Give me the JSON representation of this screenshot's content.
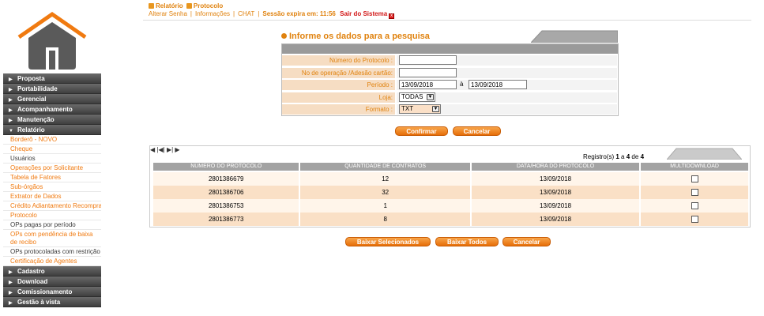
{
  "header": {
    "breadcrumb": {
      "section": "Relatório",
      "page": "Protocolo"
    },
    "links": [
      "Alterar Senha",
      "Informações",
      "CHAT"
    ],
    "session_text": "Sessão expira em: 11:56",
    "logout_label": "Sair do Sistema",
    "logout_icon": "close-x-icon"
  },
  "sidebar": {
    "logo_icon": "house-icon",
    "sections_top": [
      {
        "label": "Proposta",
        "expanded": false
      },
      {
        "label": "Portabilidade",
        "expanded": false
      },
      {
        "label": "Gerencial",
        "expanded": false
      },
      {
        "label": "Acompanhamento",
        "expanded": false
      },
      {
        "label": "Manutenção",
        "expanded": false
      },
      {
        "label": "Relatório",
        "expanded": true
      }
    ],
    "sub_items": [
      {
        "label": "Borderô - NOVO"
      },
      {
        "label": "Cheque"
      },
      {
        "label": "Usuários"
      },
      {
        "label": "Operações por Solicitante"
      },
      {
        "label": "Tabela de Fatores"
      },
      {
        "label": "Sub-órgãos"
      },
      {
        "label": "Extrator de Dados"
      },
      {
        "label": "Crédito Adiantamento Recompra"
      },
      {
        "label": "Protocolo"
      },
      {
        "label": "OPs pagas por período"
      },
      {
        "label": "OPs com pendência de baixa de recibo"
      },
      {
        "label": "OPs protocoladas com restrição"
      },
      {
        "label": "Certificação de Agentes"
      }
    ],
    "sections_bottom": [
      {
        "label": "Cadastro"
      },
      {
        "label": "Download"
      },
      {
        "label": "Comissionamento"
      },
      {
        "label": "Gestão à vista"
      }
    ]
  },
  "form": {
    "title": "Informe os dados para a pesquisa",
    "fields": {
      "protocolo": {
        "label": "Número do Protocolo :",
        "value": ""
      },
      "operacao": {
        "label": "No de operação /Adesão cartão:",
        "value": ""
      },
      "periodo": {
        "label": "Período :",
        "from": "13/09/2018",
        "separator": "à",
        "to": "13/09/2018"
      },
      "loja": {
        "label": "Loja:",
        "value": "TODAS"
      },
      "formato": {
        "label": "Formato :",
        "value": "TXT"
      }
    },
    "confirm_label": "Confirmar",
    "cancel_label": "Cancelar"
  },
  "results": {
    "registros": {
      "prefix": "Registro(s)",
      "from": "1",
      "to_word": "a",
      "to": "4",
      "of_word": "de",
      "total": "4"
    },
    "pager": {
      "first": "◀",
      "prev": "|◀|",
      "next": "▶|",
      "last": "▶"
    },
    "columns": [
      "NÚMERO DO PROTOCOLO",
      "QUANTIDADE DE CONTRATOS",
      "DATA/HORA DO PROTOCOLO",
      "MULTIDOWNLOAD"
    ],
    "rows": [
      {
        "protocolo": "2801386679",
        "quantidade": "12",
        "data": "13/09/2018",
        "checked": false
      },
      {
        "protocolo": "2801386706",
        "quantidade": "32",
        "data": "13/09/2018",
        "checked": false
      },
      {
        "protocolo": "2801386753",
        "quantidade": "1",
        "data": "13/09/2018",
        "checked": false
      },
      {
        "protocolo": "2801386773",
        "quantidade": "8",
        "data": "13/09/2018",
        "checked": false
      }
    ],
    "download_selected_label": "Baixar Selecionados",
    "download_all_label": "Baixar Todos",
    "cancel_label": "Cancelar"
  }
}
